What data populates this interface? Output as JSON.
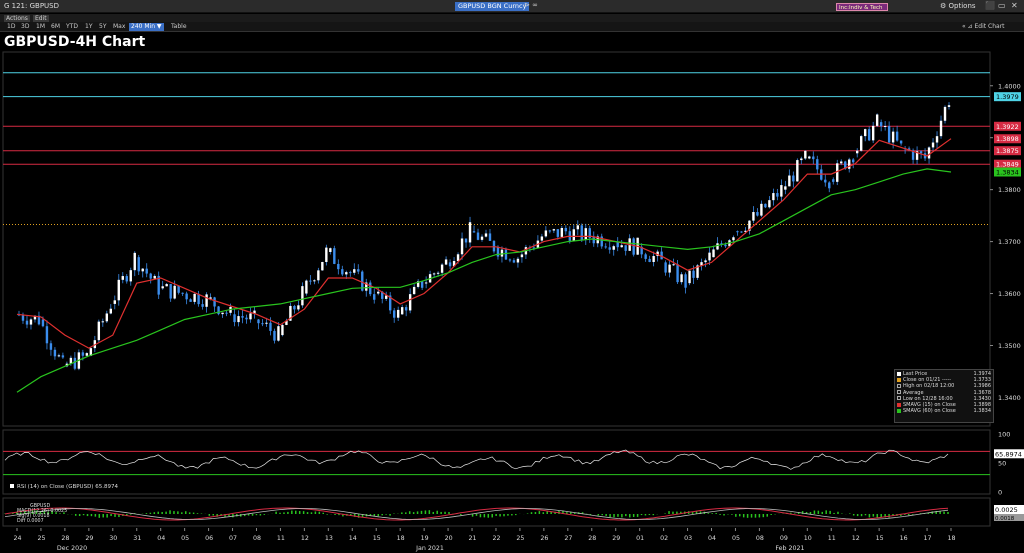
{
  "window": {
    "tab_title": "G 121: GBPUSD",
    "security": "GBPUSD BGN Curncy",
    "magenta_box": "Inc:Indiv & Tech",
    "options_label": "Options",
    "actions_label": "Actions",
    "edit_label": "Edit",
    "edit_chart_label": "Edit Chart",
    "options_icon": "gear-icon",
    "arrows": "⊳  ∞",
    "win_controls": [
      "⬛",
      "▭",
      "✕"
    ]
  },
  "toolbar": {
    "timeframes": [
      "1D",
      "3D",
      "1M",
      "6M",
      "YTD",
      "1Y",
      "5Y",
      "Max",
      "240 Min ▼",
      "Table"
    ],
    "selected": "240 Min ▼"
  },
  "chart_title": "GBPUSD-4H Chart",
  "colors": {
    "candle": "#3b8ded",
    "sma15": "#e0302f",
    "sma60": "#29c41e",
    "hline_red": "#d62b43",
    "hline_cyan": "#4fd3e6",
    "dotted": "#e0a020"
  },
  "price_axis": {
    "ticks": [
      "1.4000",
      "1.3900",
      "1.3800",
      "1.3700",
      "1.3600",
      "1.3500",
      "1.3400"
    ],
    "min": 1.3345,
    "max": 1.4065,
    "badges": [
      {
        "label": "1.3979",
        "value": 1.3979,
        "color": "#4fd3e6",
        "text_color": "#000"
      },
      {
        "label": "1.3922",
        "value": 1.3922,
        "color": "#d62b43",
        "text_color": "#fff"
      },
      {
        "label": "1.3898",
        "value": 1.3898,
        "color": "#d62b43",
        "text_color": "#fff"
      },
      {
        "label": "1.3875",
        "value": 1.3875,
        "color": "#d62b43",
        "text_color": "#fff"
      },
      {
        "label": "1.3849",
        "value": 1.3849,
        "color": "#d62b43",
        "text_color": "#fff"
      },
      {
        "label": "1.3834",
        "value": 1.3834,
        "color": "#29c41e",
        "text_color": "#000"
      }
    ],
    "hlines": [
      {
        "value": 1.4025,
        "color": "#4fd3e6"
      },
      {
        "value": 1.3979,
        "color": "#4fd3e6"
      },
      {
        "value": 1.3922,
        "color": "#d62b43"
      },
      {
        "value": 1.3875,
        "color": "#d62b43"
      },
      {
        "value": 1.3849,
        "color": "#d62b43"
      },
      {
        "value": 1.3733,
        "color": "#e0a020",
        "dotted": true
      }
    ]
  },
  "legend": [
    {
      "swatch": "#ffffff",
      "label": "Last Price",
      "value": "1.3974"
    },
    {
      "swatch": "#e0a020",
      "label": "Close on 01/21 -----",
      "value": "1.3733"
    },
    {
      "swatch": "",
      "label": "High on 02/18 12:00",
      "value": "1.3986"
    },
    {
      "swatch": "",
      "label": "Average",
      "value": "1.3678"
    },
    {
      "swatch": "",
      "label": "Low on 12/28 16:00",
      "value": "1.3430"
    },
    {
      "swatch": "#e0302f",
      "label": "SMAVG (15)  on Close",
      "value": "1.3898"
    },
    {
      "swatch": "#29c41e",
      "label": "SMAVG (60)  on Close",
      "value": "1.3834"
    }
  ],
  "rsi": {
    "label": "RSI (14)  on Close (GBPUSD)  65.8974",
    "ticks": [
      "100",
      "50",
      "0"
    ],
    "badge": "65.8974"
  },
  "macd": {
    "lines": [
      "GBPUSD",
      "MACD(12,26)  0.0025",
      "Sig(9)  0.0018",
      "Diff  0.0007"
    ],
    "badge": "0.0025",
    "badge2": "0.0018"
  },
  "x_axis": {
    "days": [
      "24",
      "25",
      "28",
      "29",
      "30",
      "31",
      "04",
      "05",
      "06",
      "07",
      "08",
      "11",
      "12",
      "13",
      "14",
      "15",
      "18",
      "19",
      "20",
      "21",
      "22",
      "25",
      "26",
      "27",
      "28",
      "29",
      "01",
      "02",
      "03",
      "04",
      "05",
      "08",
      "09",
      "10",
      "11",
      "12",
      "15",
      "16",
      "17",
      "18"
    ],
    "months": [
      {
        "label": "Dec 2020",
        "index": 2
      },
      {
        "label": "Jan 2021",
        "index": 17
      },
      {
        "label": "Feb 2021",
        "index": 32
      }
    ]
  },
  "chart_data": {
    "type": "line",
    "title": "GBPUSD-4H Chart",
    "x": [
      "12/24",
      "12/25",
      "12/28",
      "12/29",
      "12/30",
      "12/31",
      "01/04",
      "01/05",
      "01/06",
      "01/07",
      "01/08",
      "01/11",
      "01/12",
      "01/13",
      "01/14",
      "01/15",
      "01/18",
      "01/19",
      "01/20",
      "01/21",
      "01/22",
      "01/25",
      "01/26",
      "01/27",
      "01/28",
      "01/29",
      "02/01",
      "02/02",
      "02/03",
      "02/04",
      "02/05",
      "02/08",
      "02/09",
      "02/10",
      "02/11",
      "02/12",
      "02/15",
      "02/16",
      "02/17",
      "02/18"
    ],
    "series": [
      {
        "name": "Last Price",
        "values": [
          1.356,
          1.355,
          1.346,
          1.348,
          1.358,
          1.367,
          1.361,
          1.36,
          1.359,
          1.356,
          1.355,
          1.352,
          1.36,
          1.368,
          1.364,
          1.36,
          1.356,
          1.362,
          1.366,
          1.372,
          1.369,
          1.367,
          1.371,
          1.372,
          1.371,
          1.37,
          1.369,
          1.366,
          1.362,
          1.367,
          1.372,
          1.375,
          1.38,
          1.386,
          1.382,
          1.387,
          1.393,
          1.388,
          1.386,
          1.3974
        ]
      },
      {
        "name": "SMAVG (15)  on Close",
        "values": [
          1.356,
          1.3555,
          1.352,
          1.3495,
          1.352,
          1.362,
          1.363,
          1.361,
          1.359,
          1.3575,
          1.356,
          1.354,
          1.357,
          1.363,
          1.363,
          1.361,
          1.358,
          1.36,
          1.364,
          1.369,
          1.369,
          1.368,
          1.37,
          1.371,
          1.371,
          1.37,
          1.369,
          1.367,
          1.3645,
          1.366,
          1.37,
          1.374,
          1.378,
          1.383,
          1.383,
          1.385,
          1.3895,
          1.388,
          1.3865,
          1.3898
        ]
      },
      {
        "name": "SMAVG (60)  on Close",
        "values": [
          1.341,
          1.344,
          1.346,
          1.348,
          1.3495,
          1.351,
          1.353,
          1.355,
          1.356,
          1.357,
          1.3575,
          1.358,
          1.359,
          1.36,
          1.361,
          1.3612,
          1.3612,
          1.3625,
          1.364,
          1.366,
          1.3675,
          1.368,
          1.369,
          1.37,
          1.3705,
          1.37,
          1.3695,
          1.369,
          1.3685,
          1.369,
          1.37,
          1.3715,
          1.374,
          1.3765,
          1.379,
          1.38,
          1.3815,
          1.383,
          1.384,
          1.3834
        ]
      }
    ],
    "ylim": [
      1.3345,
      1.4065
    ]
  }
}
